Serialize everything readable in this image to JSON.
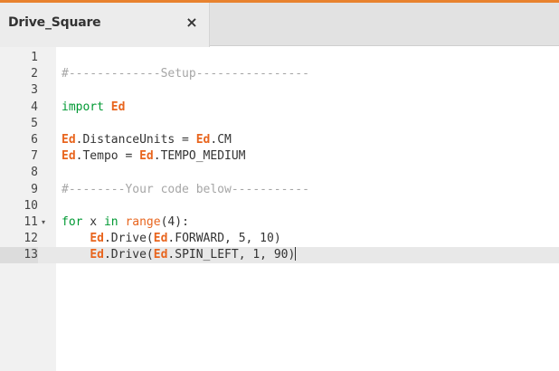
{
  "tab": {
    "title": "Drive_Square",
    "close_symbol": "×"
  },
  "colors": {
    "accent": "#e8822e",
    "ed_orange": "#e8651e",
    "keyword": "#009933",
    "comment": "#a6a6a6"
  },
  "editor": {
    "active_line": 13,
    "lines": [
      {
        "n": "1",
        "tokens": []
      },
      {
        "n": "2",
        "tokens": [
          {
            "t": "#-------------Setup----------------",
            "c": "comment"
          }
        ]
      },
      {
        "n": "3",
        "tokens": []
      },
      {
        "n": "4",
        "tokens": [
          {
            "t": "import ",
            "c": "keyword"
          },
          {
            "t": "Ed",
            "c": "ed"
          }
        ]
      },
      {
        "n": "5",
        "tokens": []
      },
      {
        "n": "6",
        "tokens": [
          {
            "t": "Ed",
            "c": "ed"
          },
          {
            "t": ".DistanceUnits = ",
            "c": "plain"
          },
          {
            "t": "Ed",
            "c": "ed"
          },
          {
            "t": ".CM",
            "c": "plain"
          }
        ]
      },
      {
        "n": "7",
        "tokens": [
          {
            "t": "Ed",
            "c": "ed"
          },
          {
            "t": ".Tempo = ",
            "c": "plain"
          },
          {
            "t": "Ed",
            "c": "ed"
          },
          {
            "t": ".TEMPO_MEDIUM",
            "c": "plain"
          }
        ]
      },
      {
        "n": "8",
        "tokens": []
      },
      {
        "n": "9",
        "tokens": [
          {
            "t": "#--------Your code below-----------",
            "c": "comment"
          }
        ]
      },
      {
        "n": "10",
        "tokens": []
      },
      {
        "n": "11",
        "fold": "▾",
        "tokens": [
          {
            "t": "for",
            "c": "keyword"
          },
          {
            "t": " x ",
            "c": "plain"
          },
          {
            "t": "in",
            "c": "keyword"
          },
          {
            "t": " ",
            "c": "plain"
          },
          {
            "t": "range",
            "c": "fn"
          },
          {
            "t": "(4):",
            "c": "plain"
          }
        ]
      },
      {
        "n": "12",
        "tokens": [
          {
            "t": "    ",
            "c": "plain"
          },
          {
            "t": "Ed",
            "c": "ed"
          },
          {
            "t": ".Drive(",
            "c": "plain"
          },
          {
            "t": "Ed",
            "c": "ed"
          },
          {
            "t": ".FORWARD, 5, 10)",
            "c": "plain"
          }
        ]
      },
      {
        "n": "13",
        "tokens": [
          {
            "t": "    ",
            "c": "plain"
          },
          {
            "t": "Ed",
            "c": "ed"
          },
          {
            "t": ".Drive(",
            "c": "plain"
          },
          {
            "t": "Ed",
            "c": "ed"
          },
          {
            "t": ".SPIN_LEFT, 1, 90)",
            "c": "plain"
          }
        ]
      }
    ]
  }
}
